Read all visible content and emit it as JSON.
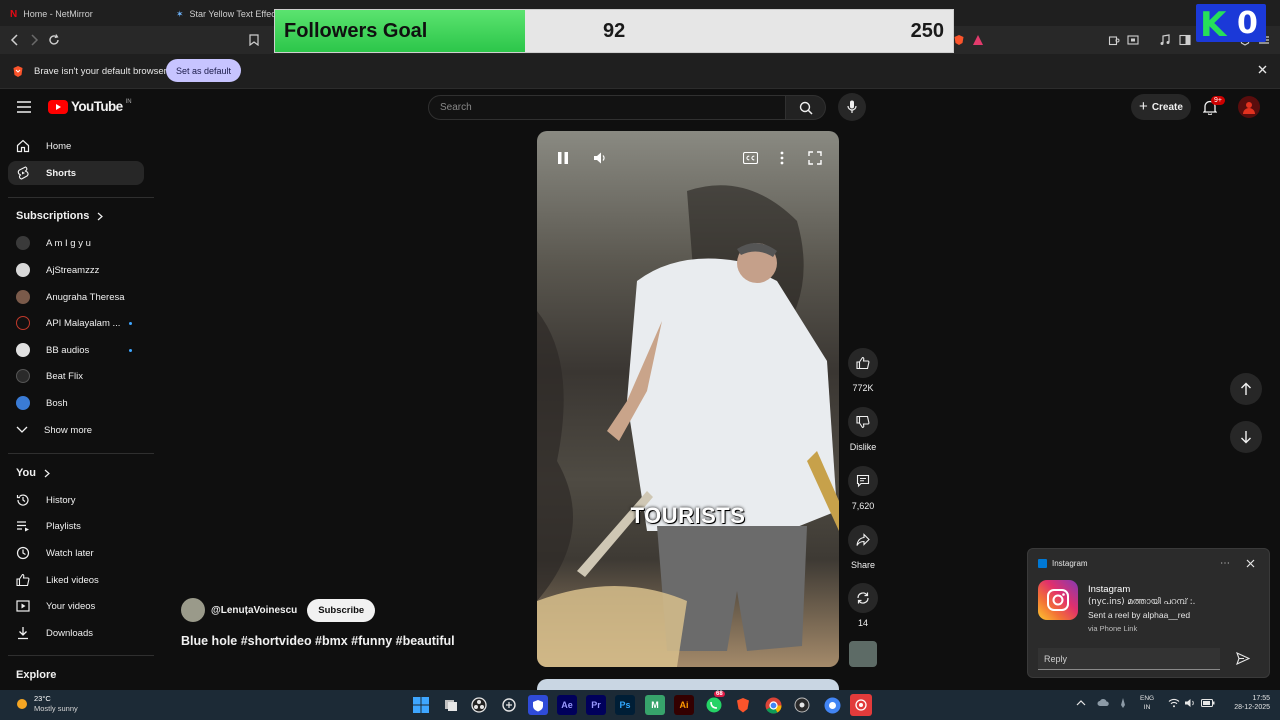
{
  "browser": {
    "tabs": [
      {
        "title": "Home - NetMirror",
        "icon": "netflix-icon"
      },
      {
        "title": "Star Yellow Text Effect | F",
        "icon": "star-icon"
      }
    ],
    "infobar": {
      "message": "Brave isn't your default browser",
      "button": "Set as default"
    }
  },
  "overlay": {
    "title": "Followers Goal",
    "current": "92",
    "target": "250",
    "progress": 0.368,
    "badge_letter": "K",
    "badge_number": "0"
  },
  "youtube": {
    "logo_text": "YouTube",
    "region": "IN",
    "search_placeholder": "Search",
    "create_label": "Create",
    "notif_count": "9+"
  },
  "sidebar": {
    "main": [
      {
        "label": "Home",
        "icon": "home-icon"
      },
      {
        "label": "Shorts",
        "icon": "shorts-icon",
        "active": true
      }
    ],
    "subscriptions_title": "Subscriptions",
    "subscriptions": [
      {
        "label": "A m I g y u",
        "color": "#3a3a3a"
      },
      {
        "label": "AjStreamzzz",
        "color": "#d8d8d8"
      },
      {
        "label": "Anugraha Theresa",
        "color": "#7a5a4a"
      },
      {
        "label": "API Malayalam ...",
        "color": "#111111",
        "dot": true
      },
      {
        "label": "BB audios",
        "color": "#e0e0e0",
        "dot": true
      },
      {
        "label": "Beat Flix",
        "color": "#2a2a2a"
      },
      {
        "label": "Bosh",
        "color": "#3a7bd5"
      }
    ],
    "show_more": "Show more",
    "you_title": "You",
    "you_items": [
      {
        "label": "History",
        "icon": "history-icon"
      },
      {
        "label": "Playlists",
        "icon": "playlists-icon"
      },
      {
        "label": "Watch later",
        "icon": "watch-later-icon"
      },
      {
        "label": "Liked videos",
        "icon": "like-icon"
      },
      {
        "label": "Your videos",
        "icon": "your-videos-icon"
      },
      {
        "label": "Downloads",
        "icon": "download-icon"
      }
    ],
    "explore_title": "Explore"
  },
  "short": {
    "caption": "TOURISTS",
    "channel": "@LenuțaVoinescu",
    "subscribe": "Subscribe",
    "title": "Blue hole #shortvideo #bmx #funny #beautiful",
    "likes": "772K",
    "dislike": "Dislike",
    "comments": "7,620",
    "share": "Share",
    "remix": "14"
  },
  "notification": {
    "app": "Instagram",
    "title": "Instagram",
    "line1": "(nyc.ins) മത്തായി പറമ്പ് :.",
    "line2": "Sent a reel by alphaa__red",
    "via": "via Phone Link",
    "reply_placeholder": "Reply"
  },
  "taskbar": {
    "weather_temp": "23°C",
    "weather_desc": "Mostly sunny",
    "lang_top": "ENG",
    "lang_bottom": "IN",
    "time": "17:55",
    "date": "28-12-2025",
    "whatsapp_badge": "68"
  }
}
